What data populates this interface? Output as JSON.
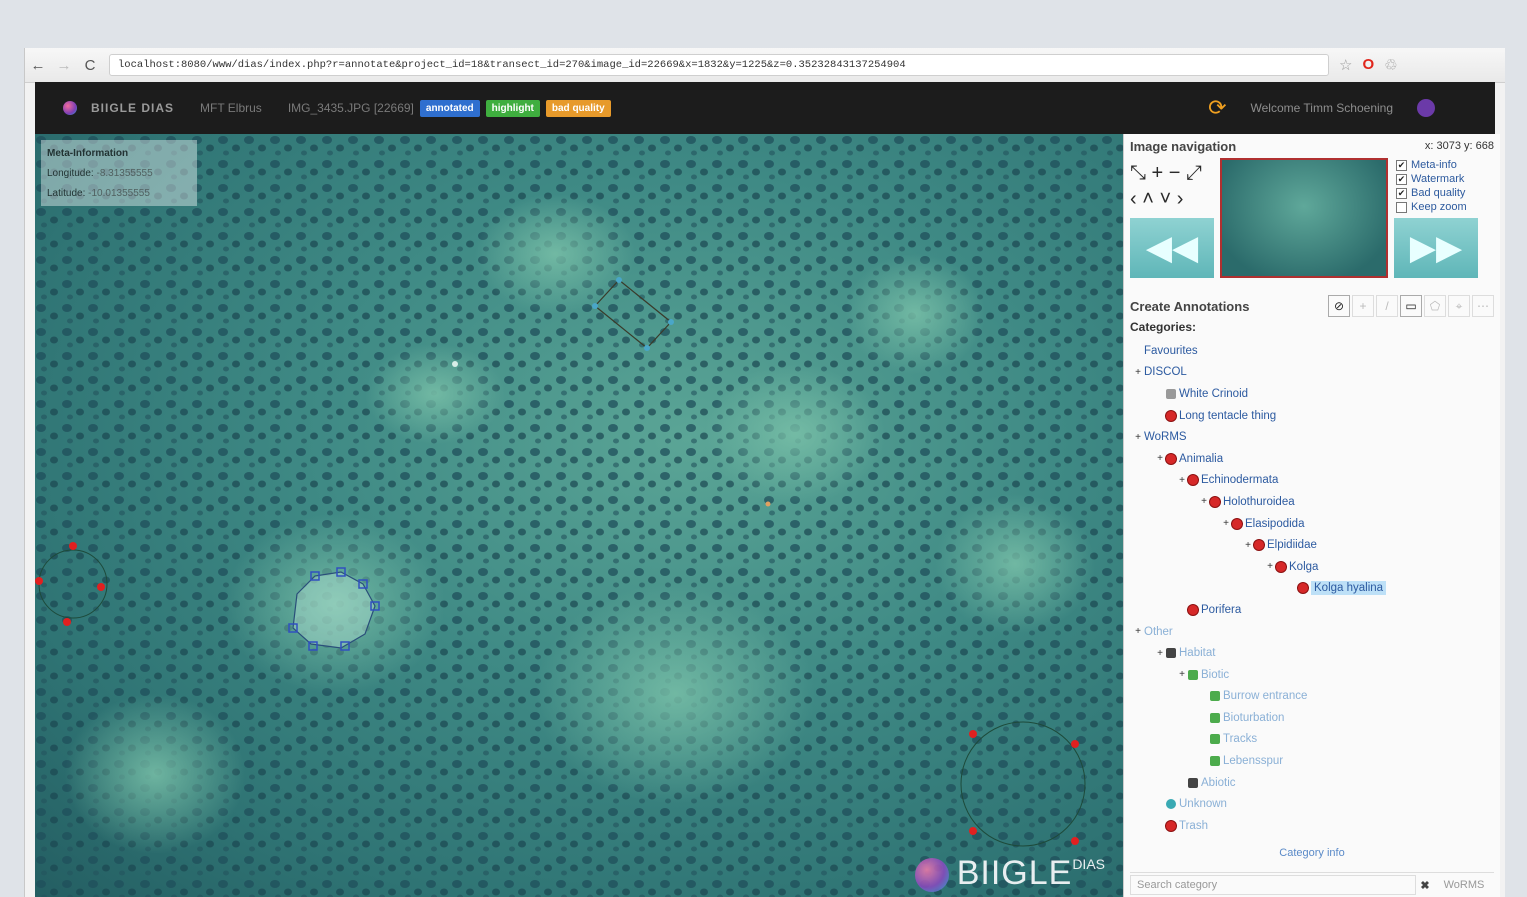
{
  "browser": {
    "back": "←",
    "forward": "→",
    "reload": "C",
    "url": "localhost:8080/www/dias/index.php?r=annotate&project_id=18&transect_id=270&image_id=22669&x=1832&y=1225&z=0.35232843137254904",
    "star": "☆",
    "opera": "O",
    "ext": "♲"
  },
  "appbar": {
    "app_name": "BIIGLE DIAS",
    "crumb_project": "MFT Elbrus",
    "crumb_image": "IMG_3435.JPG [22669]",
    "badges": [
      "annotated",
      "highlight",
      "bad quality"
    ],
    "refresh": "⟳",
    "welcome": "Welcome Timm Schoening"
  },
  "meta": {
    "title": "Meta-Information",
    "longitude_label": "Longitude:",
    "longitude_value": "-8.31355555",
    "latitude_label": "Latitude:",
    "latitude_value": "-10.01355555"
  },
  "watermark": {
    "text": "BIIGLE",
    "sup": "DIAS"
  },
  "panel": {
    "nav_title": "Image navigation",
    "coords": "x: 3073 y: 668",
    "nav_tools": [
      "⤡ + − ⤢",
      "‹ ˄ ˅ ›"
    ],
    "prev": "◀◀",
    "next": "▶▶",
    "options": [
      {
        "label": "Meta-info",
        "checked": "✔"
      },
      {
        "label": "Watermark",
        "checked": "✔"
      },
      {
        "label": "Bad quality",
        "checked": "✔"
      },
      {
        "label": "Keep zoom",
        "checked": ""
      }
    ],
    "create_title": "Create Annotations",
    "tools": [
      "⊘",
      "+",
      "/",
      "▭",
      "⬠",
      "⌖",
      "⋯"
    ],
    "categories_label": "Categories:",
    "category_info": "Category info",
    "search_placeholder": "Search category",
    "search_clear": "✖",
    "search_scope": "WoRMS"
  },
  "tree": [
    {
      "label": "Favourites",
      "indent": 0,
      "sym": "",
      "icon": ""
    },
    {
      "label": "DISCOL",
      "indent": 0,
      "sym": "+",
      "icon": ""
    },
    {
      "label": "White Crinoid",
      "indent": 1,
      "sym": "",
      "icon": "grey"
    },
    {
      "label": "Long tentacle thing",
      "indent": 1,
      "sym": "",
      "icon": "red"
    },
    {
      "label": "WoRMS",
      "indent": 0,
      "sym": "+",
      "icon": ""
    },
    {
      "label": "Animalia",
      "indent": 1,
      "sym": "+",
      "icon": "red"
    },
    {
      "label": "Echinodermata",
      "indent": 2,
      "sym": "+",
      "icon": "red"
    },
    {
      "label": "Holothuroidea",
      "indent": 3,
      "sym": "+",
      "icon": "red"
    },
    {
      "label": "Elasipodida",
      "indent": 4,
      "sym": "+",
      "icon": "red"
    },
    {
      "label": "Elpidiidae",
      "indent": 5,
      "sym": "+",
      "icon": "red"
    },
    {
      "label": "Kolga",
      "indent": 6,
      "sym": "+",
      "icon": "red"
    },
    {
      "label": "Kolga hyalina",
      "indent": 7,
      "sym": "",
      "icon": "red",
      "selected": true
    },
    {
      "label": "Porifera",
      "indent": 2,
      "sym": "",
      "icon": "red"
    },
    {
      "label": "Other",
      "indent": 0,
      "sym": "+",
      "icon": "",
      "faded": true
    },
    {
      "label": "Habitat",
      "indent": 1,
      "sym": "+",
      "icon": "dark",
      "faded": true
    },
    {
      "label": "Biotic",
      "indent": 2,
      "sym": "+",
      "icon": "green",
      "faded": true
    },
    {
      "label": "Burrow entrance",
      "indent": 3,
      "sym": "",
      "icon": "green",
      "faded": true
    },
    {
      "label": "Bioturbation",
      "indent": 3,
      "sym": "",
      "icon": "green",
      "faded": true
    },
    {
      "label": "Tracks",
      "indent": 3,
      "sym": "",
      "icon": "green",
      "faded": true
    },
    {
      "label": "Lebensspur",
      "indent": 3,
      "sym": "",
      "icon": "green",
      "faded": true
    },
    {
      "label": "Abiotic",
      "indent": 2,
      "sym": "",
      "icon": "dark",
      "faded": true
    },
    {
      "label": "Unknown",
      "indent": 1,
      "sym": "",
      "icon": "teal",
      "faded": true
    },
    {
      "label": "Trash",
      "indent": 1,
      "sym": "",
      "icon": "red",
      "faded": true
    }
  ],
  "colors": {
    "appbar": "#1c1c1c",
    "seafloor": "#3f8a85",
    "accent_orange": "#f0a020",
    "badge_blue": "#2f6fcf",
    "badge_green": "#3fae3f",
    "badge_orange": "#e79a2b",
    "selected": "#bde0f7",
    "annotation_red": "#e02020",
    "annotation_blue": "#3050c0"
  }
}
